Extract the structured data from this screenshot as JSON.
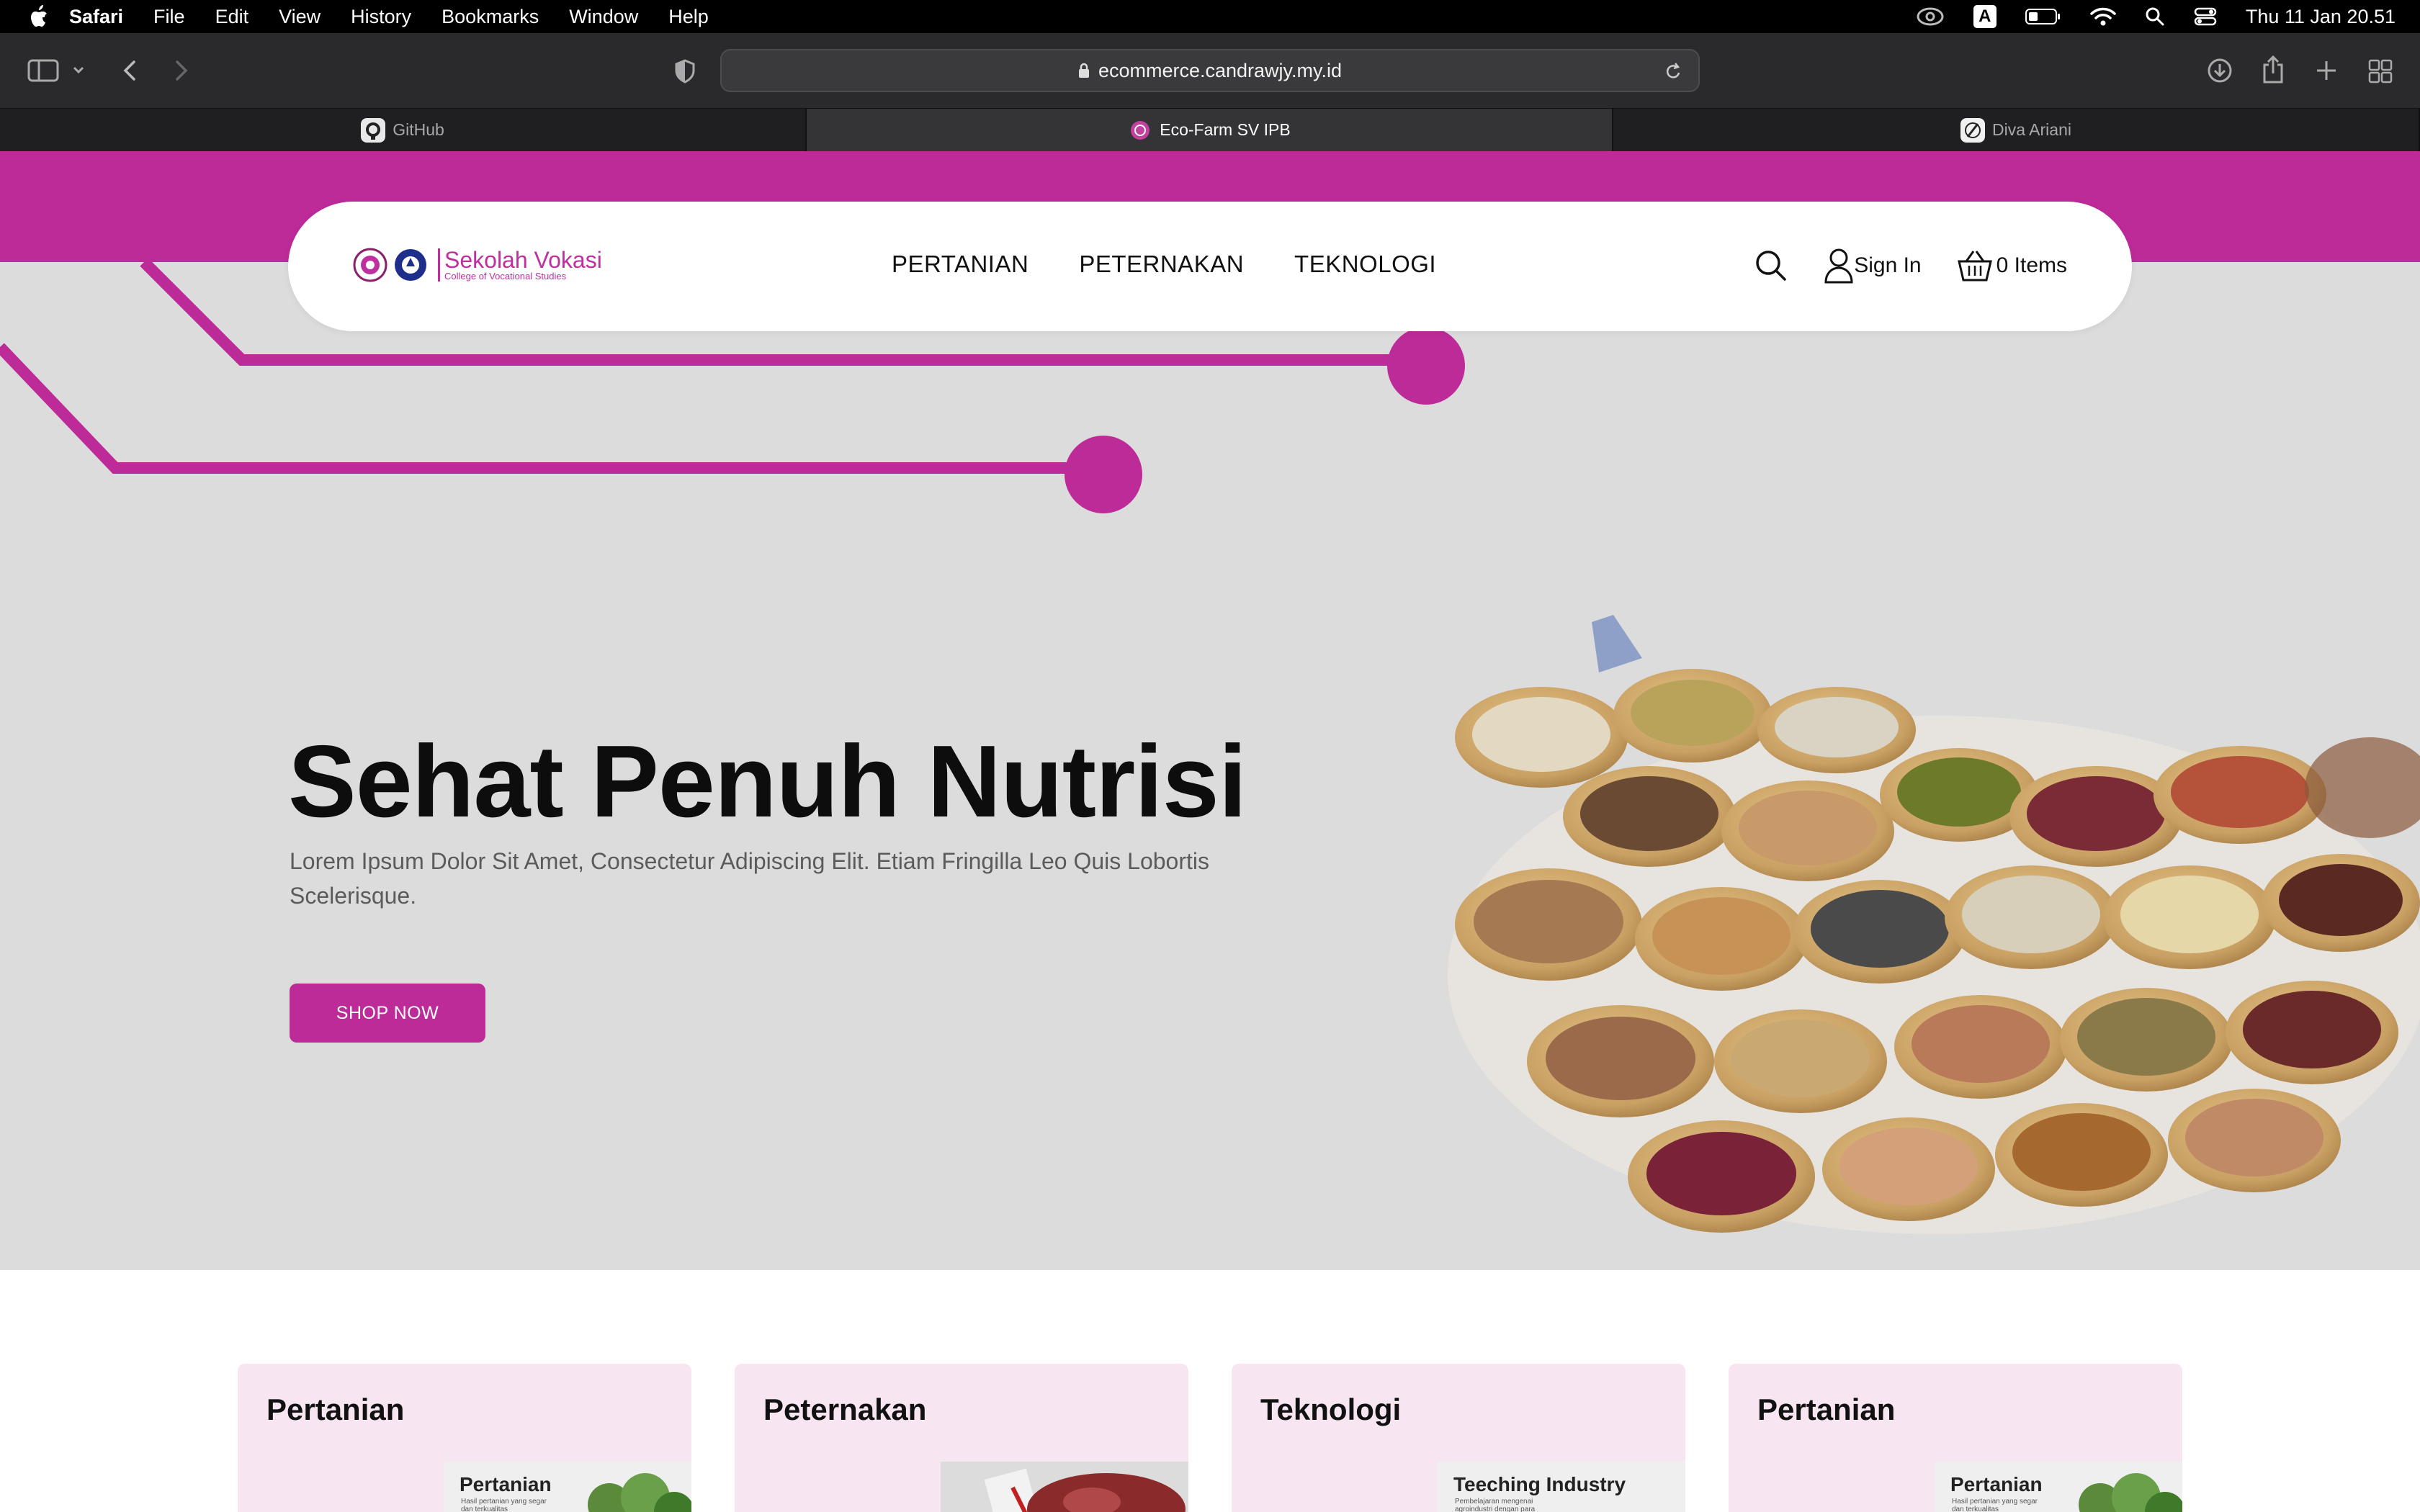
{
  "menubar": {
    "app": "Safari",
    "items": [
      "File",
      "Edit",
      "View",
      "History",
      "Bookmarks",
      "Window",
      "Help"
    ],
    "status_input": "A",
    "datetime": "Thu 11 Jan  20.51"
  },
  "browser": {
    "url": "ecommerce.candrawjy.my.id",
    "tabs": [
      {
        "label": "GitHub",
        "icon": "github-icon",
        "active": false
      },
      {
        "label": "Eco-Farm SV IPB",
        "icon": "ecofarm-favicon",
        "active": true
      },
      {
        "label": "Diva Ariani",
        "icon": "site-favicon",
        "active": false
      }
    ]
  },
  "site": {
    "colors": {
      "brand": "#bd2b99",
      "hero_bg": "#dddcdc",
      "card_bg": "#f7e5f2"
    },
    "logo": {
      "title": "Sekolah Vokasi",
      "subtitle": "College of Vocational Studies"
    },
    "nav": [
      "PERTANIAN",
      "PETERNAKAN",
      "TEKNOLOGI"
    ],
    "sign_in": "Sign In",
    "cart": "0 Items",
    "hero": {
      "title": "Sehat Penuh Nutrisi",
      "description": "Lorem Ipsum Dolor Sit Amet, Consectetur Adipiscing Elit. Etiam Fringilla Leo Quis Lobortis Scelerisque.",
      "button": "SHOP NOW"
    },
    "categories": [
      {
        "title": "Pertanian",
        "thumb_title": "Pertanian",
        "thumb_sub": "Hasil pertanian yang segar dan terkualitas"
      },
      {
        "title": "Peternakan",
        "thumb_title": "",
        "thumb_sub": ""
      },
      {
        "title": "Teknologi",
        "thumb_title": "Teeching Industry",
        "thumb_sub": "Pembelajaran mengenai agroindustri dengan para ahli"
      },
      {
        "title": "Pertanian",
        "thumb_title": "Pertanian",
        "thumb_sub": "Hasil pertanian yang segar dan terkualitas"
      }
    ]
  }
}
